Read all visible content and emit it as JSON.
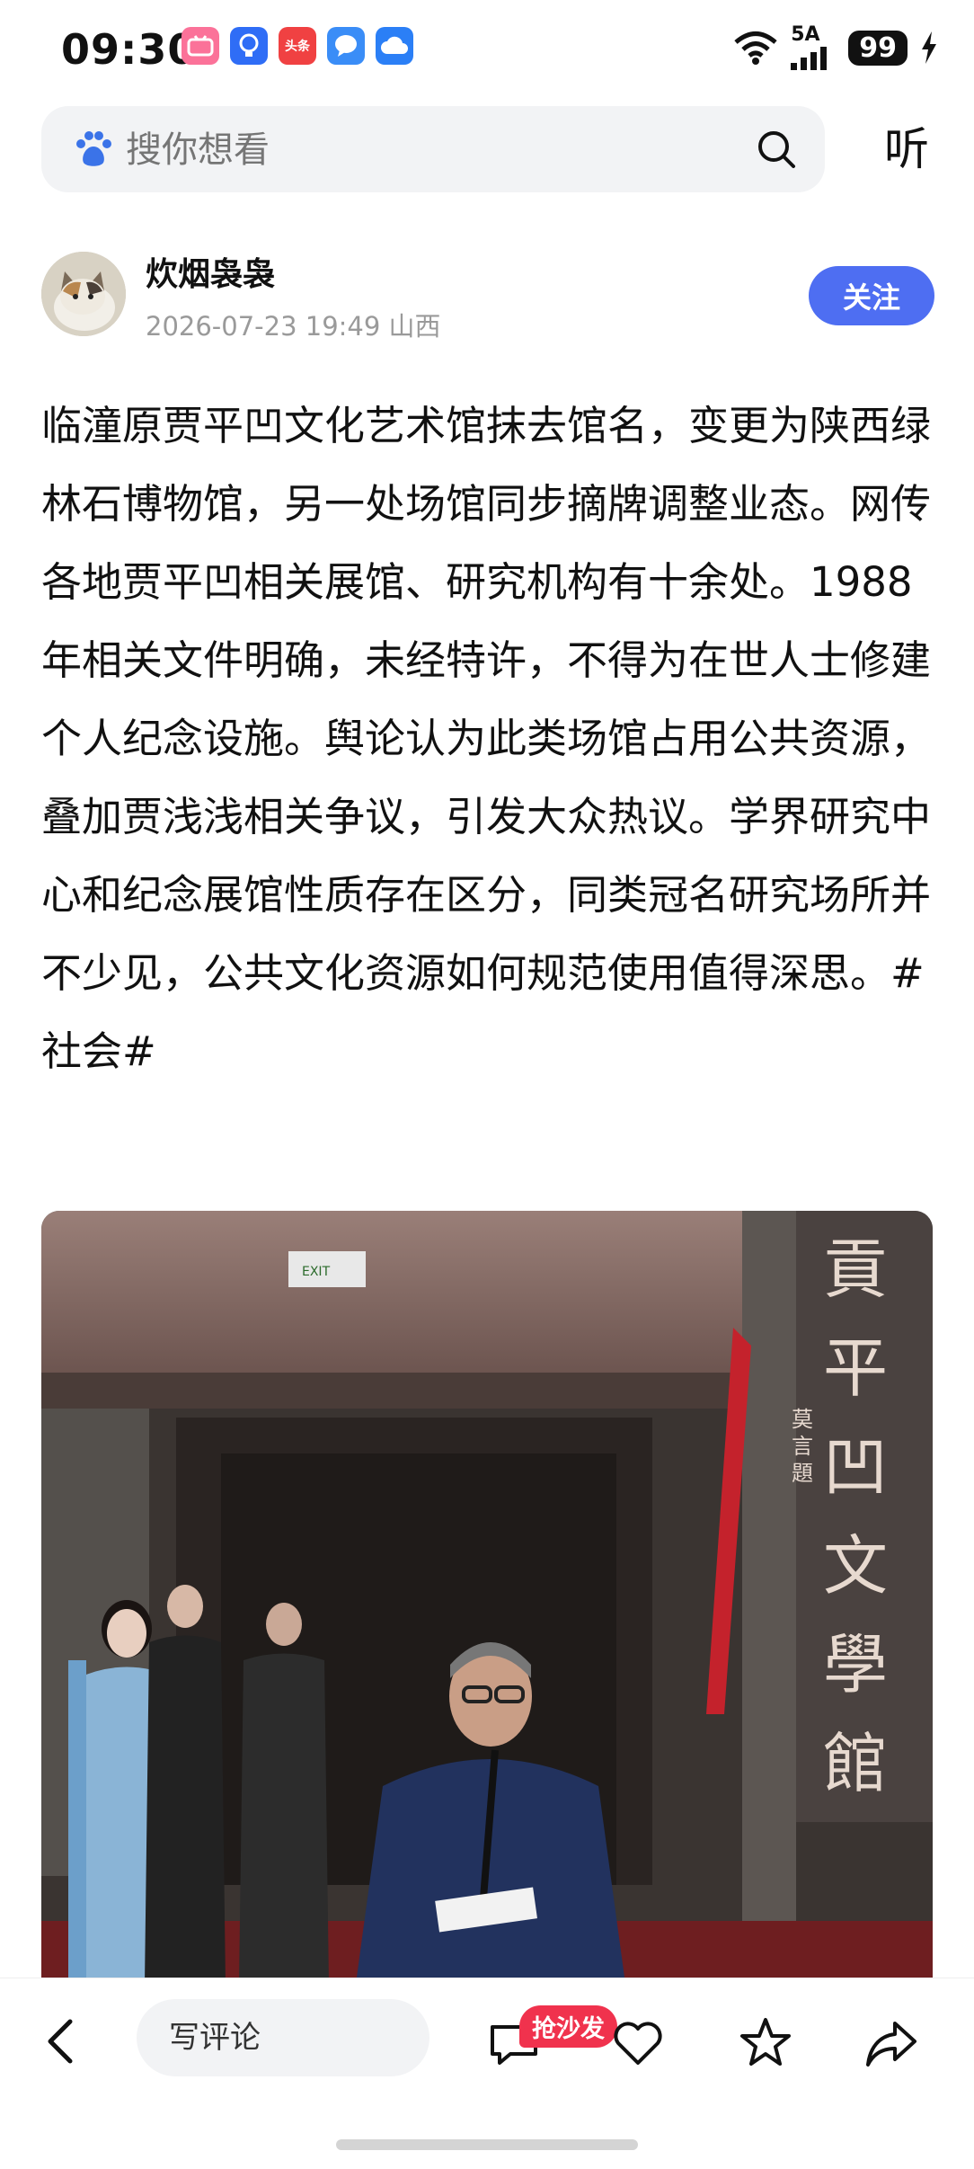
{
  "status_bar": {
    "time": "09:30",
    "network": "5A",
    "battery": "99",
    "app_icons": [
      "bilibili-icon",
      "bulb-icon",
      "toutiao-icon",
      "message-icon",
      "cloud-icon"
    ],
    "toutiao_label": "头条"
  },
  "search": {
    "placeholder": "搜你想看",
    "listen_label": "听"
  },
  "author": {
    "name": "炊烟袅袅",
    "datetime": "2026-07-23 19:49",
    "location": "山西",
    "follow_label": "关注"
  },
  "article": {
    "text": "临潼原贾平凹文化艺术馆抹去馆名，变更为陕西绿林石博物馆，另一处场馆同步摘牌调整业态。网传各地贾平凹相关展馆、研究机构有十余处。1988年相关文件明确，未经特许，不得为在世人士修建个人纪念设施。舆论认为此类场馆占用公共资源，叠加贾浅浅相关争议，引发大众热议。学界研究中心和纪念展馆性质存在区分，同类冠名研究场所并不少见，公共文化资源如何规范使用值得深思。#社会#"
  },
  "photo": {
    "plaque_text": "贾平凹文學館",
    "plaque_signature": "莫言題",
    "exit_sign": "EXIT"
  },
  "bottom_bar": {
    "comment_placeholder": "写评论",
    "sofa_badge": "抢沙发"
  },
  "colors": {
    "accent": "#4e6ef2",
    "badge": "#f0324d",
    "search_bg": "#f2f3f5",
    "meta_gray": "#9a9a9a"
  }
}
